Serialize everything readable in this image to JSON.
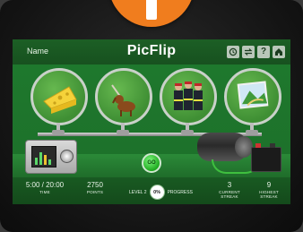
{
  "header": {
    "name_label": "Name",
    "title": "PicFlip",
    "buttons": [
      {
        "icon": "history-icon"
      },
      {
        "icon": "swap-icon"
      },
      {
        "icon": "help-icon",
        "glyph": "?"
      },
      {
        "icon": "home-icon"
      }
    ]
  },
  "cards": [
    {
      "icon": "cheese-icon"
    },
    {
      "icon": "dog-icon"
    },
    {
      "icon": "firefighters-icon"
    },
    {
      "icon": "landscape-icon"
    }
  ],
  "go_button": {
    "label": "GO"
  },
  "hud": {
    "time": {
      "value": "5:00 / 20:00",
      "label": "Time"
    },
    "points": {
      "value": "2750",
      "label": "Points"
    },
    "level": {
      "prefix": "LEVEL 2",
      "progress_value": "0%",
      "progress_label": "Progress"
    },
    "current_streak": {
      "value": "3",
      "label": "Current Streak"
    },
    "highest_streak": {
      "value": "9",
      "label": "Highest Streak"
    }
  },
  "colors": {
    "accent_orange": "#f07d1e",
    "screen_green": "#1f7a2e",
    "go_green": "#1faa1f"
  }
}
